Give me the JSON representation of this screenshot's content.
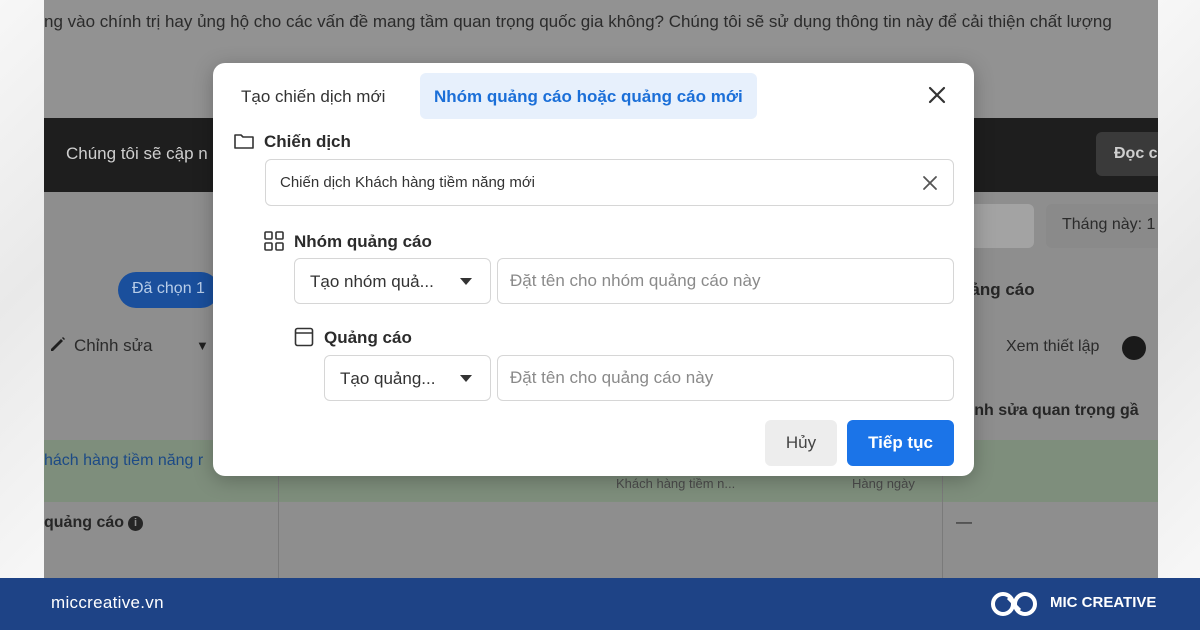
{
  "background": {
    "top_text": "ng vào chính trị hay ủng hộ cho các vấn đề mang tầm quan trọng quốc gia không? Chúng tôi sẽ sử dụng thông tin này để cải thiện chất lượng",
    "banner_text": "Chúng tôi sẽ cập n",
    "banner_button": "Đọc c",
    "month_label": "Tháng này: 1",
    "selected_badge": "Đã chọn 1",
    "ads_title": "uảng cáo",
    "edit_label": "Chỉnh sửa",
    "view_settings": "Xem thiết lập",
    "important_edits": "hỉnh sửa quan trọng gầ",
    "row_campaign_name": "hách hàng tiềm năng r",
    "col_audience": "Khách hàng tiềm n...",
    "col_budget": "Hàng ngày",
    "row_ads_label": "quảng cáo",
    "dash": "—"
  },
  "modal": {
    "tabs": {
      "new_campaign": "Tạo chiến dịch mới",
      "new_adset": "Nhóm quảng cáo hoặc quảng cáo mới"
    },
    "campaign": {
      "label": "Chiến dịch",
      "value": "Chiến dịch Khách hàng tiềm năng mới"
    },
    "adset": {
      "label": "Nhóm quảng cáo",
      "select_value": "Tạo nhóm quả...",
      "name_placeholder": "Đặt tên cho nhóm quảng cáo này"
    },
    "ad": {
      "label": "Quảng cáo",
      "select_value": "Tạo quảng...",
      "name_placeholder": "Đặt tên cho quảng cáo này"
    },
    "buttons": {
      "cancel": "Hủy",
      "continue": "Tiếp tục"
    }
  },
  "footer": {
    "url": "miccreative.vn",
    "brand": "MIC CREATIVE"
  },
  "colors": {
    "accent": "#1b74e8",
    "active_tab_bg": "#e7f0fc",
    "footer_bg": "#1e4386"
  }
}
